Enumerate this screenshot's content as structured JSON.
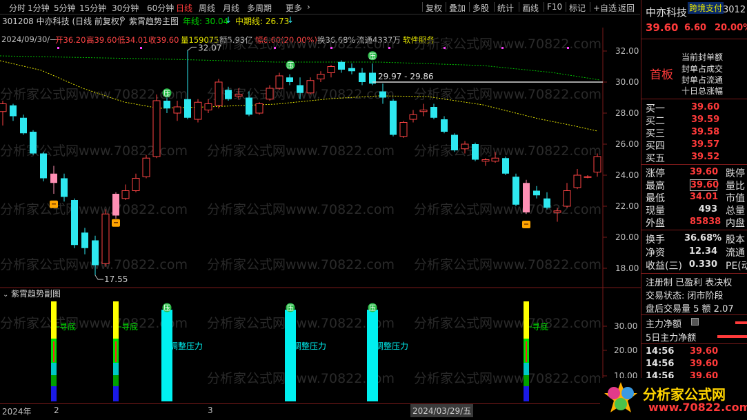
{
  "toolbar": {
    "left_items": [
      "分时",
      "1分钟",
      "5分钟",
      "15分钟",
      "30分钟",
      "60分钟",
      "日线",
      "周线",
      "月线",
      "多周期",
      "更多"
    ],
    "active": "日线",
    "more_chevron": "chevron-right-icon",
    "right_items": [
      "复权",
      "叠加",
      "多股",
      "统计",
      "画线",
      "F10",
      "标记",
      "+自选",
      "返回"
    ]
  },
  "stock": {
    "code_title": "301208 中亦科技 (日线 前复权)",
    "indicator_name": "紫霄趋势主图",
    "ma_long_label": "年线: 30.04",
    "ma_mid_label": "中期线: 26.73",
    "date": "2024/09/30/—",
    "open": "开36.20",
    "high": "高39.60",
    "low": "低34.01",
    "close": "收39.60",
    "volume": "量159075",
    "amount": "额5.93亿",
    "change": "幅6.60(20.00%)",
    "turnover": "换36.68%",
    "float": "流通4337万",
    "sector": "软件服务"
  },
  "main_chart": {
    "y_ticks": [
      "32.00",
      "30.00",
      "28.00",
      "26.00",
      "24.00",
      "22.00",
      "20.00",
      "18.00"
    ],
    "high_label": "32.07",
    "low_label": "17.55",
    "price_line_label": "29.97 - 29.86",
    "watermark": "分析家公式网www.70822.com",
    "colors": {
      "up": "#ff4545",
      "down": "#2ee8f0",
      "pink": "#ff8fb4",
      "ma_long": "#00c000",
      "ma_mid": "#e6e600"
    }
  },
  "sub_chart": {
    "title": "紫霄趋势副图",
    "y_ticks": [
      "30.00",
      "20.00",
      "10.00"
    ],
    "labels": {
      "seek_bottom": "寻底",
      "adjust": "调整压力",
      "ya": "压"
    }
  },
  "bottom_axis": {
    "labels": [
      "2024年",
      "2",
      "3",
      "2024/03/29/五"
    ]
  },
  "right_panel": {
    "name": "中亦科技",
    "tag": "跨境支付",
    "code_partial": "3012",
    "price": "39.60",
    "change": "6.60",
    "pct": "20.00%",
    "board": "首板",
    "board_info": [
      "当前封单额",
      "封单占成交",
      "封单占流通",
      "十日总涨幅"
    ],
    "order_book": [
      {
        "label": "买一",
        "price": "39.60"
      },
      {
        "label": "买二",
        "price": "39.59"
      },
      {
        "label": "买三",
        "price": "39.58"
      },
      {
        "label": "买四",
        "price": "39.57"
      },
      {
        "label": "买五",
        "price": "39.52"
      }
    ],
    "stats": [
      {
        "label": "涨停",
        "value": "39.60",
        "right": "跌停"
      },
      {
        "label": "最高",
        "value": "39.60",
        "right": "量比"
      },
      {
        "label": "最低",
        "value": "34.01",
        "right": "市值"
      },
      {
        "label": "现量",
        "value": "493",
        "right": "总量"
      },
      {
        "label": "外盘",
        "value": "85838",
        "right": "内盘"
      }
    ],
    "stats2": [
      {
        "label": "换手",
        "value": "36.68%",
        "right": "股本"
      },
      {
        "label": "净资",
        "value": "12.34",
        "right": "流通"
      },
      {
        "label": "收益(三)",
        "value": "0.330",
        "right": "PE(动"
      }
    ],
    "info_lines": [
      "注册制  已盈利  表决权",
      "交易状态: 闭市阶段",
      "盘后交易量 5 额 2.07"
    ],
    "flow": [
      {
        "label": "主力净额"
      },
      {
        "label": "5日主力净额"
      }
    ],
    "ticks": [
      {
        "time": "14:56",
        "price": "39.60"
      },
      {
        "time": "14:56",
        "price": "39.60"
      },
      {
        "time": "14:56",
        "price": "39.60"
      }
    ]
  },
  "logo": {
    "text": "分析家公式网",
    "url": "www.70822.com"
  }
}
